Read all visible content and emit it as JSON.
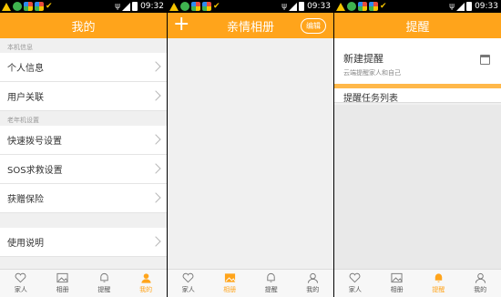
{
  "statusbar": {
    "times": [
      "09:32",
      "09:33",
      "09:33"
    ]
  },
  "panel1": {
    "title": "我的",
    "sections": [
      {
        "header": "本机信息",
        "items": [
          "个人信息",
          "用户关联"
        ]
      },
      {
        "header": "老年机设置",
        "items": [
          "快速拨号设置",
          "SOS求救设置",
          "获赠保险"
        ]
      },
      {
        "header": "",
        "items": [
          "使用说明"
        ]
      }
    ]
  },
  "panel2": {
    "title": "亲情相册",
    "edit_label": "编辑",
    "add_symbol": "+"
  },
  "panel3": {
    "title": "提醒",
    "new_reminder_title": "新建提醒",
    "new_reminder_sub": "云端提醒家人和自己",
    "list_header": "提醒任务列表"
  },
  "nav": {
    "items": [
      "家人",
      "相册",
      "提醒",
      "我的"
    ],
    "active": [
      "我的",
      "相册",
      "提醒"
    ]
  },
  "colors": {
    "accent": "#ffa41b",
    "background": "#f0f0f0"
  },
  "icons": [
    "warning-icon",
    "wechat-icon",
    "app-icon",
    "check-icon",
    "usb-icon",
    "signal-icon",
    "battery-icon",
    "calendar-icon",
    "heart-icon",
    "picture-icon",
    "bell-icon",
    "person-icon"
  ]
}
